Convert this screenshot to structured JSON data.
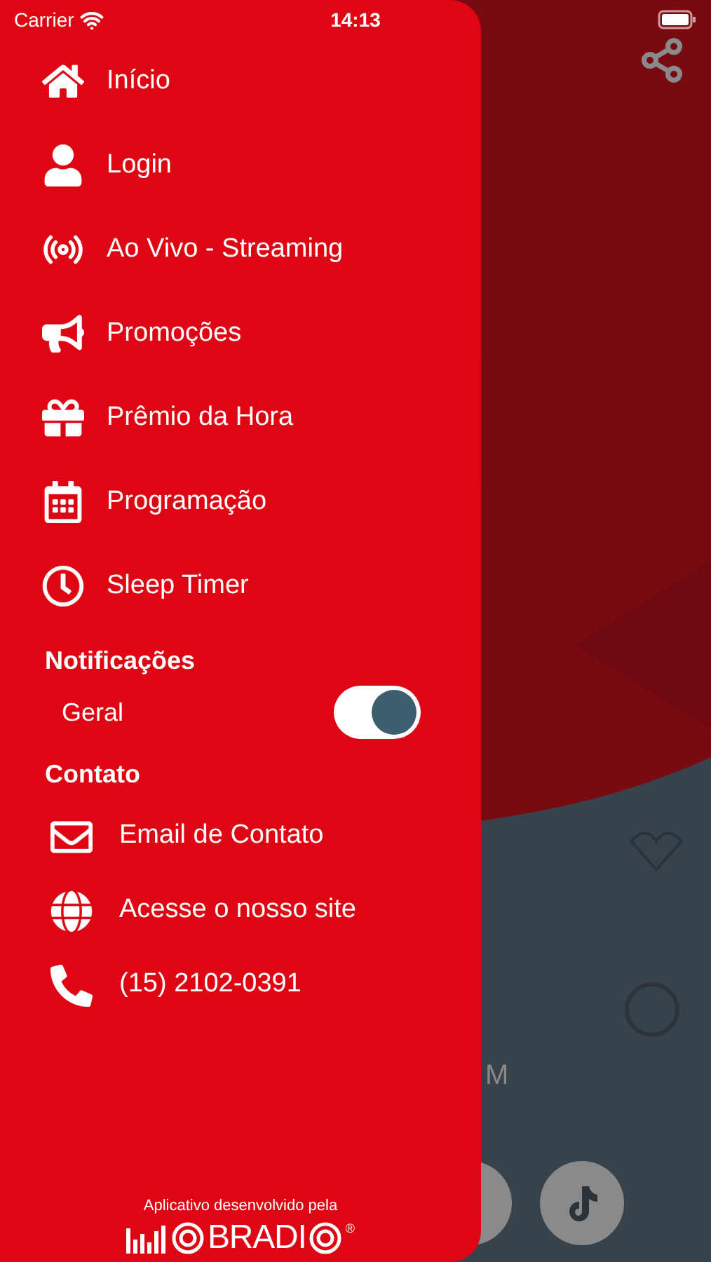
{
  "status_bar": {
    "carrier": "Carrier",
    "time": "14:13"
  },
  "menu": [
    {
      "label": "Início"
    },
    {
      "label": "Login"
    },
    {
      "label": "Ao Vivo - Streaming"
    },
    {
      "label": "Promoções"
    },
    {
      "label": "Prêmio da Hora"
    },
    {
      "label": "Programação"
    },
    {
      "label": "Sleep Timer"
    }
  ],
  "notifications": {
    "title": "Notificações",
    "items": [
      {
        "label": "Geral",
        "on": true
      }
    ]
  },
  "contact": {
    "title": "Contato",
    "items": [
      {
        "label": "Email de Contato"
      },
      {
        "label": "Acesse o nosso site"
      },
      {
        "label": "(15) 2102-0391"
      }
    ]
  },
  "footer": {
    "credit": "Aplicativo desenvolvido pela",
    "logo_text": "BRADI",
    "registered": "®"
  },
  "background_app": {
    "caption": "M"
  }
}
